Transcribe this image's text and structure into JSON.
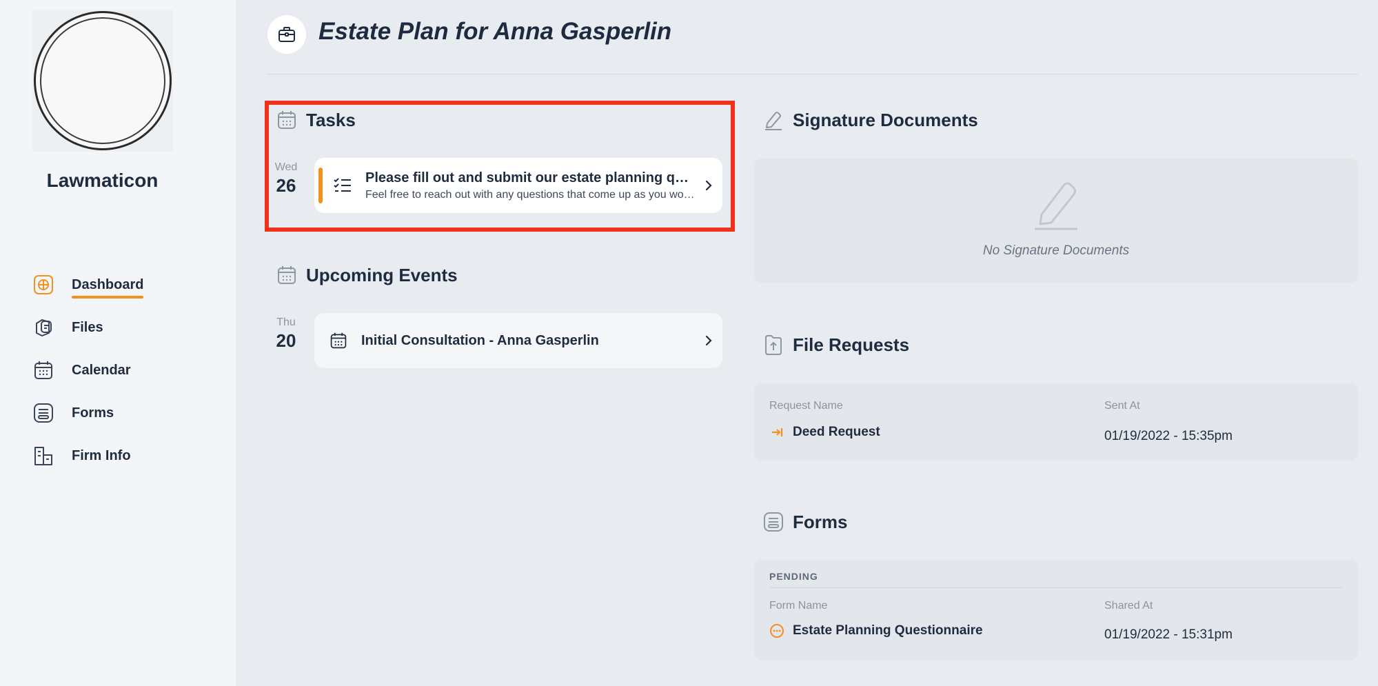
{
  "sidebar": {
    "brand": "Lawmaticon",
    "items": [
      {
        "label": "Dashboard",
        "icon": "dashboard-icon",
        "active": true
      },
      {
        "label": "Files",
        "icon": "files-icon"
      },
      {
        "label": "Calendar",
        "icon": "calendar-icon"
      },
      {
        "label": "Forms",
        "icon": "forms-icon"
      },
      {
        "label": "Firm Info",
        "icon": "firm-info-icon"
      }
    ]
  },
  "header": {
    "title": "Estate Plan for Anna Gasperlin",
    "icon": "briefcase-icon"
  },
  "tasks": {
    "title": "Tasks",
    "items": [
      {
        "day": "Wed",
        "date": "26",
        "title": "Please fill out and submit our estate planning questionnaire",
        "subtitle": "Feel free to reach out with any questions that come up as you work through it"
      }
    ]
  },
  "events": {
    "title": "Upcoming Events",
    "items": [
      {
        "day": "Thu",
        "date": "20",
        "title": "Initial Consultation - Anna Gasperlin"
      }
    ]
  },
  "signature": {
    "title": "Signature Documents",
    "empty_text": "No Signature Documents"
  },
  "file_requests": {
    "title": "File Requests",
    "col_name": "Request Name",
    "col_date": "Sent At",
    "rows": [
      {
        "name": "Deed Request",
        "date": "01/19/2022 - 15:35pm"
      }
    ]
  },
  "forms": {
    "title": "Forms",
    "group": "PENDING",
    "col_name": "Form Name",
    "col_date": "Shared At",
    "rows": [
      {
        "name": "Estate Planning Questionnaire",
        "date": "01/19/2022 - 15:31pm"
      }
    ]
  },
  "colors": {
    "accent": "#f2921e",
    "highlight": "#f0321a",
    "text": "#1f2b3f"
  }
}
